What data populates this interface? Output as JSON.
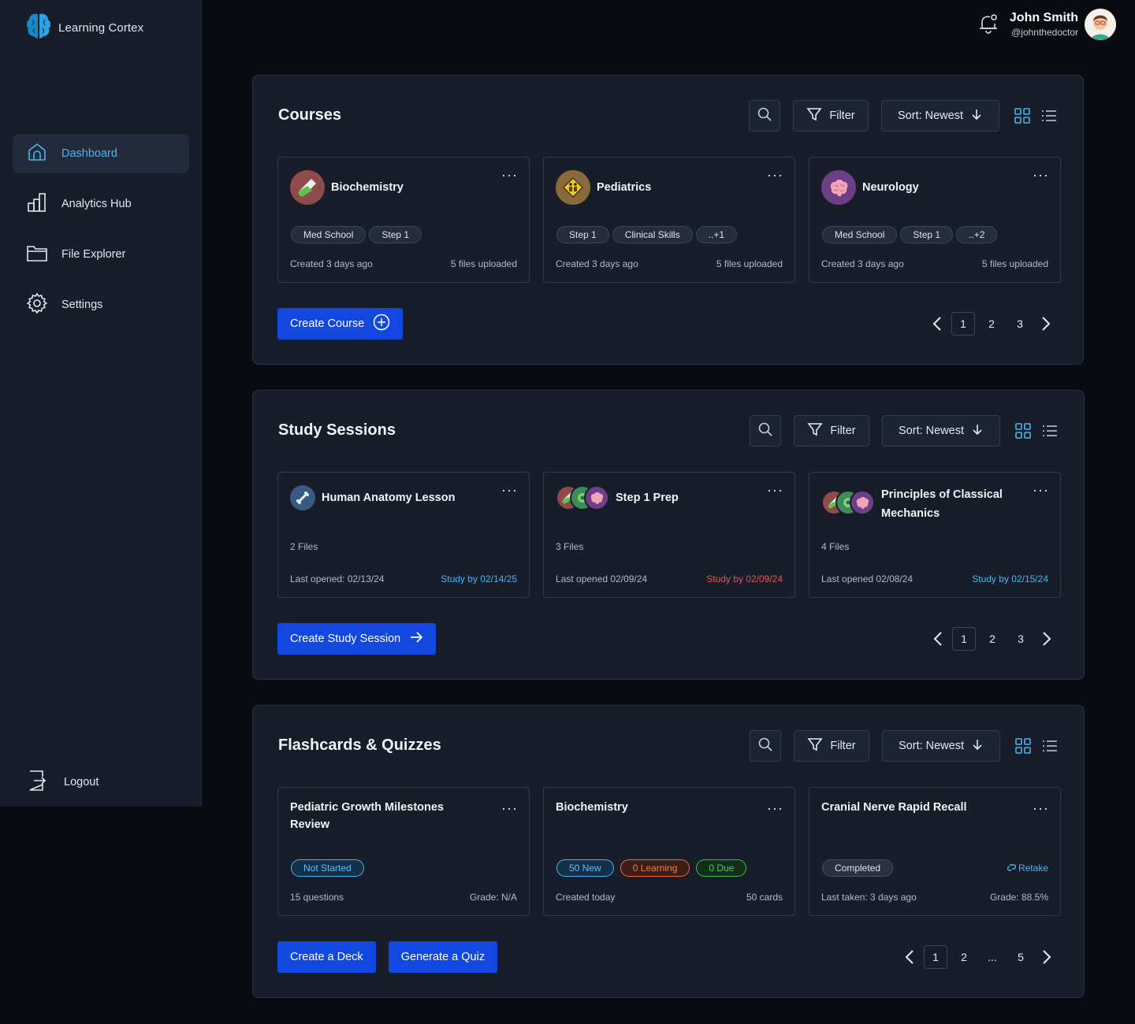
{
  "app": {
    "name": "Learning Cortex"
  },
  "nav": {
    "dashboard": "Dashboard",
    "analytics": "Analytics Hub",
    "files": "File Explorer",
    "settings": "Settings",
    "logout": "Logout"
  },
  "user": {
    "name": "John Smith",
    "handle": "@johnthedoctor"
  },
  "common": {
    "filter": "Filter",
    "sort": "Sort: Newest"
  },
  "courses": {
    "title": "Courses",
    "items": [
      {
        "name": "Biochemistry",
        "tags": [
          "Med School",
          "Step 1"
        ],
        "created": "Created 3 days ago",
        "files": "5 files uploaded"
      },
      {
        "name": "Pediatrics",
        "tags": [
          "Step 1",
          "Clinical Skills",
          "..+1"
        ],
        "created": "Created 3 days ago",
        "files": "5 files uploaded"
      },
      {
        "name": "Neurology",
        "tags": [
          "Med School",
          "Step 1",
          "..+2"
        ],
        "created": "Created 3 days ago",
        "files": "5 files uploaded"
      }
    ],
    "create_label": "Create Course",
    "pages": [
      "1",
      "2",
      "3"
    ]
  },
  "sessions": {
    "title": "Study Sessions",
    "items": [
      {
        "name": "Human Anatomy Lesson",
        "files": "2 Files",
        "opened": "Last opened: 02/13/24",
        "due": "Study by 02/14/25"
      },
      {
        "name": "Step 1 Prep",
        "files": "3 Files",
        "opened": "Last opened 02/09/24",
        "due": "Study by 02/09/24"
      },
      {
        "name_line1": "Principles of Classical",
        "name_line2": "Mechanics",
        "files": "4 Files",
        "opened": "Last opened 02/08/24",
        "due": "Study by 02/15/24"
      }
    ],
    "create_label": "Create Study Session",
    "pages": [
      "1",
      "2",
      "3"
    ]
  },
  "flashcards": {
    "title": "Flashcards & Quizzes",
    "items": [
      {
        "name_line1": "Pediatric Growth Milestones",
        "name_line2": "Review",
        "status": "Not Started",
        "left": "15 questions",
        "right": "Grade: N/A"
      },
      {
        "name": "Biochemistry",
        "new": "50 New",
        "learning": "0 Learning",
        "due": "0 Due",
        "left": "Created today",
        "right": "50 cards"
      },
      {
        "name": "Cranial Nerve Rapid Recall",
        "status": "Completed",
        "retake": "Retake",
        "left": "Last taken: 3 days ago",
        "right": "Grade: 88.5%"
      }
    ],
    "deck_label": "Create a Deck",
    "quiz_label": "Generate a Quiz",
    "pages": [
      "1",
      "2",
      "...",
      "5"
    ]
  },
  "colors": {
    "accent": "#4fb3ea",
    "primary": "#1348e0",
    "overdue": "#e8554f"
  }
}
